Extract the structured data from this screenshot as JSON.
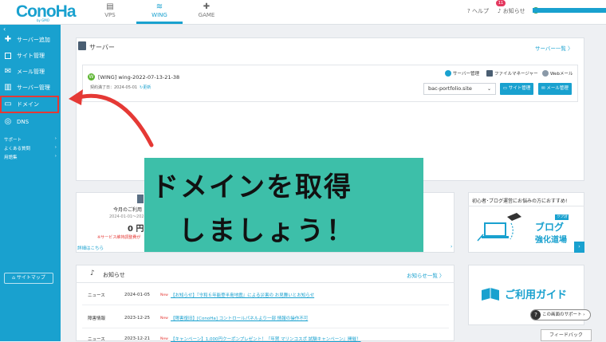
{
  "brand": {
    "logo": "ConoHa",
    "sub": "by GMO"
  },
  "tabs": [
    {
      "label": "VPS",
      "icon": "server-stack-icon"
    },
    {
      "label": "WING",
      "icon": "wing-icon"
    },
    {
      "label": "GAME",
      "icon": "gamepad-icon"
    }
  ],
  "header": {
    "help": "ヘルプ",
    "notice": "お知らせ",
    "notice_count": "11"
  },
  "sidebar": {
    "items": [
      {
        "label": "サーバー追加",
        "icon": "plus-icon"
      },
      {
        "label": "サイト管理",
        "icon": "site-icon"
      },
      {
        "label": "メール管理",
        "icon": "mail-icon"
      },
      {
        "label": "サーバー管理",
        "icon": "server-icon"
      },
      {
        "label": "ドメイン",
        "icon": "domain-icon"
      },
      {
        "label": "DNS",
        "icon": "globe-icon"
      }
    ],
    "sub": [
      {
        "label": "サポート"
      },
      {
        "label": "よくある質問"
      },
      {
        "label": "用語集"
      }
    ],
    "sitemap": "サイトマップ"
  },
  "server": {
    "title": "サーバー",
    "list_link": "サーバー一覧 〉",
    "badge": "W",
    "name": "[WING] wing-2022-07-13-21-38",
    "expire_label": "契約満了日：2024-05-01",
    "renew": "更新",
    "tools": [
      "サーバー管理",
      "ファイルマネージャー",
      "Webメール"
    ],
    "domain_select": "bac-portfolio.site",
    "site_btn": "サイト管理",
    "mail_btn": "メール管理"
  },
  "banner": {
    "line1": "ドメインを取得",
    "line2": "しましょう！"
  },
  "billing": {
    "label": "今月のご利用",
    "date": "2024-01-01～2024",
    "value": "0 円",
    "note": "※サービス維持調整費が",
    "more": "詳細はこちら"
  },
  "ad": {
    "title": "初心者･ブログ運営にお悩みの方におすすめ!",
    "tag": "ワプ活",
    "line1": "ブログ",
    "line2": "強化道場"
  },
  "news": {
    "title": "お知らせ",
    "all_link": "お知らせ一覧 〉",
    "rows": [
      {
        "cat": "ニュース",
        "date": "2024-01-05",
        "new": "New",
        "title": "【お知らせ】『令和６年能登半島地震』による災害の お見舞いとお知らせ"
      },
      {
        "cat": "障害情報",
        "date": "2023-12-25",
        "new": "New",
        "title": "【障害復旧】[ConoHa] コントロールパネルより一部 情報の操作不可"
      },
      {
        "cat": "ニュース",
        "date": "2023-12-21",
        "new": "New",
        "title": "【キャンペーン】1,000円クーポンプレゼント！『年賀 マリンコスポ 試験キャンペーン』開催！"
      }
    ]
  },
  "guide": {
    "title": "ご利用ガイド"
  },
  "support": {
    "label": "この画面のサポート",
    "q": "?"
  },
  "feedback": "フィードバック",
  "colors": {
    "brand": "#19a1cf",
    "banner": "#3dbfa9",
    "alert": "#e53935"
  }
}
